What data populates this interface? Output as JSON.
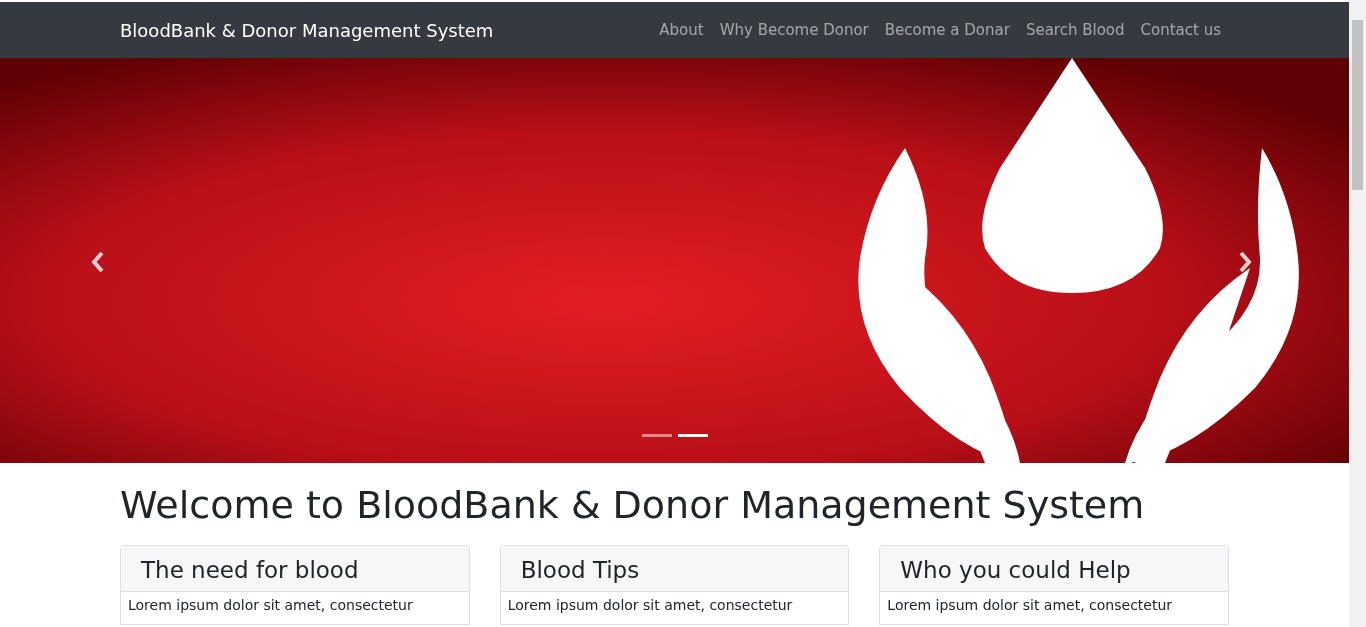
{
  "navbar": {
    "brand": "BloodBank & Donor Management System",
    "links": [
      "About",
      "Why Become Donor",
      "Become a Donar",
      "Search Blood",
      "Contact us"
    ]
  },
  "carousel": {
    "indicators": [
      {
        "selected": false
      },
      {
        "selected": true
      }
    ]
  },
  "heading": "Welcome to BloodBank & Donor Management System",
  "cards": [
    {
      "title": "The need for blood",
      "text": "Lorem ipsum dolor sit amet, consectetur"
    },
    {
      "title": "Blood Tips",
      "text": "Lorem ipsum dolor sit amet, consectetur"
    },
    {
      "title": "Who you could Help",
      "text": "Lorem ipsum dolor sit amet, consectetur"
    }
  ]
}
